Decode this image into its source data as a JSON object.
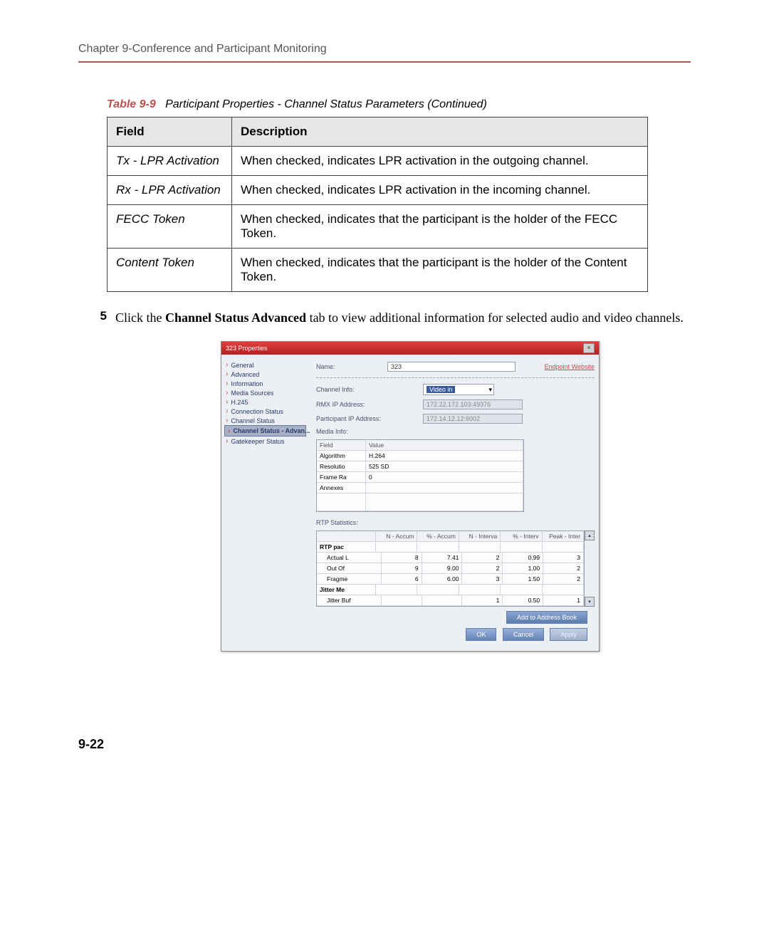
{
  "header": "Chapter 9-Conference and Participant Monitoring",
  "tableCaption": {
    "label": "Table 9-9",
    "desc": "Participant Properties - Channel Status Parameters (Continued)"
  },
  "tableHead": {
    "field": "Field",
    "desc": "Description"
  },
  "rows": [
    {
      "field": "Tx - LPR Activation",
      "desc": "When checked, indicates LPR activation in the outgoing channel."
    },
    {
      "field": "Rx - LPR Activation",
      "desc": "When checked, indicates LPR activation in the incoming channel."
    },
    {
      "field": "FECC Token",
      "desc": "When checked, indicates that the participant is the holder of the FECC Token."
    },
    {
      "field": "Content Token",
      "desc": "When checked, indicates that the participant is the holder of the Content Token."
    }
  ],
  "step": {
    "num": "5",
    "pre": "Click the ",
    "bold": "Channel Status Advanced",
    "post": " tab to view additional information for selected audio and video channels."
  },
  "dialog": {
    "title": "323 Properties",
    "side": [
      "General",
      "Advanced",
      "Information",
      "Media Sources",
      "H.245",
      "Connection Status",
      "Channel Status",
      "Channel Status - Advan...",
      "Gatekeeper Status"
    ],
    "nameLabel": "Name:",
    "nameValue": "323",
    "endpointLink": "Endpoint Website",
    "channelInfoLabel": "Channel Info:",
    "channelInfoValue": "Video in",
    "rmxLabel": "RMX IP Address:",
    "rmxValue": "172.22.172.103:49376",
    "partLabel": "Participant IP Address:",
    "partValue": "172.14.12.12:6002",
    "mediaLabel": "Media Info:",
    "media": {
      "head": [
        "Field",
        "Value"
      ],
      "rows": [
        [
          "Algorithm",
          "H.264"
        ],
        [
          "Resolutio",
          "525 SD"
        ],
        [
          "Frame Ra",
          "0"
        ],
        [
          "Annexes",
          ""
        ]
      ]
    },
    "rtpLabel": "RTP Statistics:",
    "rtpHead": [
      "",
      "N - Accum",
      "% - Accum",
      "N - Interva",
      "% - Interv",
      "Peak - Inter"
    ],
    "rtpRows": [
      {
        "sub": "RTP pac"
      },
      {
        "cells": [
          "Actual L",
          "8",
          "7.41",
          "2",
          "0.99",
          "3"
        ]
      },
      {
        "cells": [
          "Out Of",
          "9",
          "9.00",
          "2",
          "1.00",
          "2"
        ]
      },
      {
        "cells": [
          "Fragme",
          "6",
          "6.00",
          "3",
          "1.50",
          "2"
        ]
      },
      {
        "sub": "Jitter Me"
      },
      {
        "cells": [
          "Jitter Buf",
          "",
          "",
          "1",
          "0.50",
          "1"
        ]
      }
    ],
    "addBtn": "Add to Address Book",
    "ok": "OK",
    "cancel": "Cancel",
    "apply": "Apply"
  },
  "pageNum": "9-22"
}
